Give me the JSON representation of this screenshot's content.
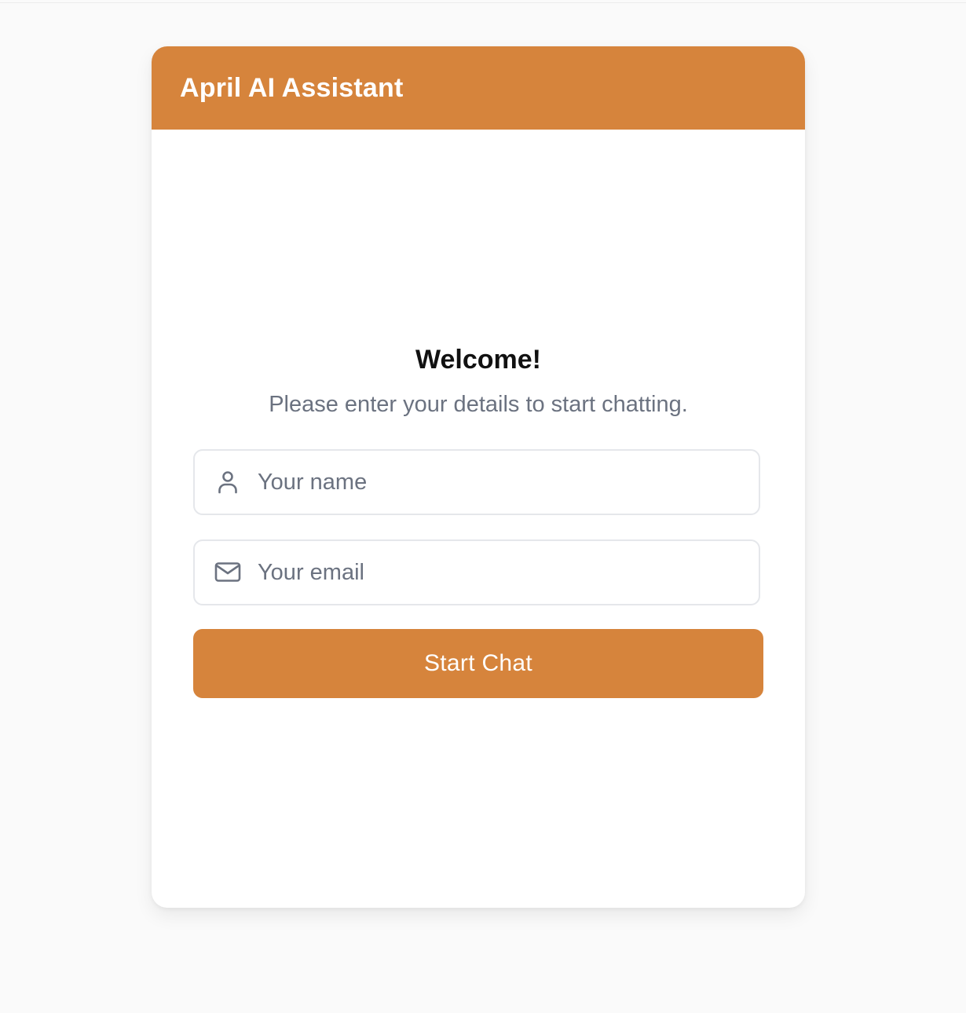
{
  "header": {
    "title": "April AI Assistant",
    "background_color": "#d6843c"
  },
  "welcome": {
    "title": "Welcome!",
    "subtitle": "Please enter your details to start chatting."
  },
  "form": {
    "name_field": {
      "icon": "user-icon",
      "value": "",
      "placeholder": "Your name"
    },
    "email_field": {
      "icon": "mail-icon",
      "value": "",
      "placeholder": "Your email"
    },
    "submit_label": "Start Chat",
    "button_color": "#d6843c"
  }
}
